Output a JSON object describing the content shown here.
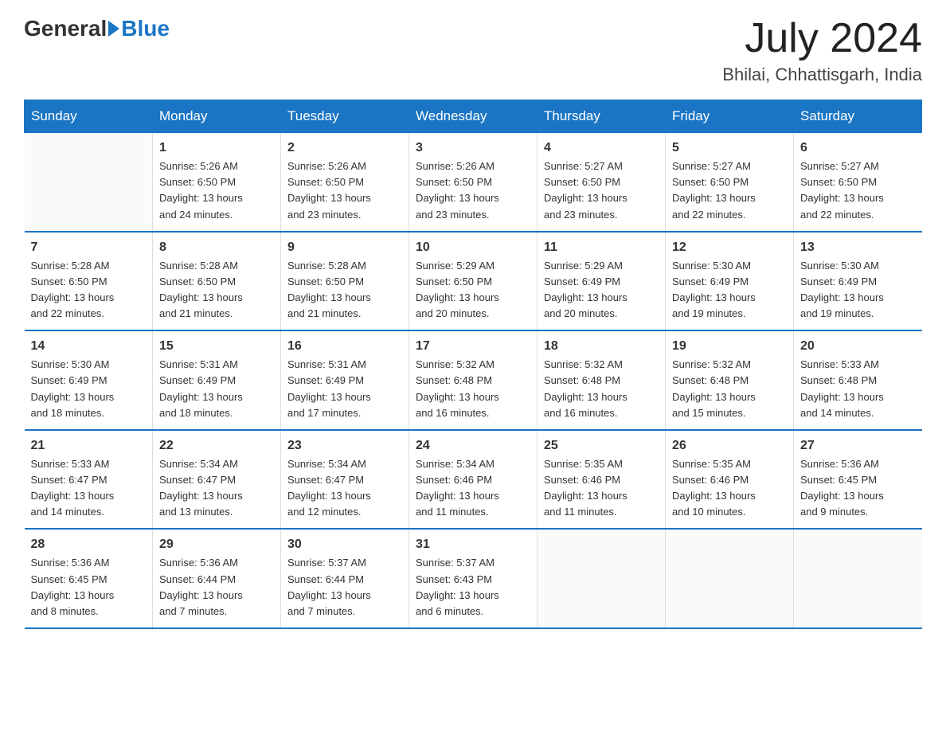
{
  "header": {
    "logo_general": "General",
    "logo_blue": "Blue",
    "month_year": "July 2024",
    "location": "Bhilai, Chhattisgarh, India"
  },
  "weekdays": [
    "Sunday",
    "Monday",
    "Tuesday",
    "Wednesday",
    "Thursday",
    "Friday",
    "Saturday"
  ],
  "weeks": [
    [
      null,
      {
        "day": "1",
        "sunrise": "5:26 AM",
        "sunset": "6:50 PM",
        "daylight": "13 hours and 24 minutes."
      },
      {
        "day": "2",
        "sunrise": "5:26 AM",
        "sunset": "6:50 PM",
        "daylight": "13 hours and 23 minutes."
      },
      {
        "day": "3",
        "sunrise": "5:26 AM",
        "sunset": "6:50 PM",
        "daylight": "13 hours and 23 minutes."
      },
      {
        "day": "4",
        "sunrise": "5:27 AM",
        "sunset": "6:50 PM",
        "daylight": "13 hours and 23 minutes."
      },
      {
        "day": "5",
        "sunrise": "5:27 AM",
        "sunset": "6:50 PM",
        "daylight": "13 hours and 22 minutes."
      },
      {
        "day": "6",
        "sunrise": "5:27 AM",
        "sunset": "6:50 PM",
        "daylight": "13 hours and 22 minutes."
      }
    ],
    [
      {
        "day": "7",
        "sunrise": "5:28 AM",
        "sunset": "6:50 PM",
        "daylight": "13 hours and 22 minutes."
      },
      {
        "day": "8",
        "sunrise": "5:28 AM",
        "sunset": "6:50 PM",
        "daylight": "13 hours and 21 minutes."
      },
      {
        "day": "9",
        "sunrise": "5:28 AM",
        "sunset": "6:50 PM",
        "daylight": "13 hours and 21 minutes."
      },
      {
        "day": "10",
        "sunrise": "5:29 AM",
        "sunset": "6:50 PM",
        "daylight": "13 hours and 20 minutes."
      },
      {
        "day": "11",
        "sunrise": "5:29 AM",
        "sunset": "6:49 PM",
        "daylight": "13 hours and 20 minutes."
      },
      {
        "day": "12",
        "sunrise": "5:30 AM",
        "sunset": "6:49 PM",
        "daylight": "13 hours and 19 minutes."
      },
      {
        "day": "13",
        "sunrise": "5:30 AM",
        "sunset": "6:49 PM",
        "daylight": "13 hours and 19 minutes."
      }
    ],
    [
      {
        "day": "14",
        "sunrise": "5:30 AM",
        "sunset": "6:49 PM",
        "daylight": "13 hours and 18 minutes."
      },
      {
        "day": "15",
        "sunrise": "5:31 AM",
        "sunset": "6:49 PM",
        "daylight": "13 hours and 18 minutes."
      },
      {
        "day": "16",
        "sunrise": "5:31 AM",
        "sunset": "6:49 PM",
        "daylight": "13 hours and 17 minutes."
      },
      {
        "day": "17",
        "sunrise": "5:32 AM",
        "sunset": "6:48 PM",
        "daylight": "13 hours and 16 minutes."
      },
      {
        "day": "18",
        "sunrise": "5:32 AM",
        "sunset": "6:48 PM",
        "daylight": "13 hours and 16 minutes."
      },
      {
        "day": "19",
        "sunrise": "5:32 AM",
        "sunset": "6:48 PM",
        "daylight": "13 hours and 15 minutes."
      },
      {
        "day": "20",
        "sunrise": "5:33 AM",
        "sunset": "6:48 PM",
        "daylight": "13 hours and 14 minutes."
      }
    ],
    [
      {
        "day": "21",
        "sunrise": "5:33 AM",
        "sunset": "6:47 PM",
        "daylight": "13 hours and 14 minutes."
      },
      {
        "day": "22",
        "sunrise": "5:34 AM",
        "sunset": "6:47 PM",
        "daylight": "13 hours and 13 minutes."
      },
      {
        "day": "23",
        "sunrise": "5:34 AM",
        "sunset": "6:47 PM",
        "daylight": "13 hours and 12 minutes."
      },
      {
        "day": "24",
        "sunrise": "5:34 AM",
        "sunset": "6:46 PM",
        "daylight": "13 hours and 11 minutes."
      },
      {
        "day": "25",
        "sunrise": "5:35 AM",
        "sunset": "6:46 PM",
        "daylight": "13 hours and 11 minutes."
      },
      {
        "day": "26",
        "sunrise": "5:35 AM",
        "sunset": "6:46 PM",
        "daylight": "13 hours and 10 minutes."
      },
      {
        "day": "27",
        "sunrise": "5:36 AM",
        "sunset": "6:45 PM",
        "daylight": "13 hours and 9 minutes."
      }
    ],
    [
      {
        "day": "28",
        "sunrise": "5:36 AM",
        "sunset": "6:45 PM",
        "daylight": "13 hours and 8 minutes."
      },
      {
        "day": "29",
        "sunrise": "5:36 AM",
        "sunset": "6:44 PM",
        "daylight": "13 hours and 7 minutes."
      },
      {
        "day": "30",
        "sunrise": "5:37 AM",
        "sunset": "6:44 PM",
        "daylight": "13 hours and 7 minutes."
      },
      {
        "day": "31",
        "sunrise": "5:37 AM",
        "sunset": "6:43 PM",
        "daylight": "13 hours and 6 minutes."
      },
      null,
      null,
      null
    ]
  ],
  "labels": {
    "sunrise": "Sunrise:",
    "sunset": "Sunset:",
    "daylight": "Daylight:"
  }
}
